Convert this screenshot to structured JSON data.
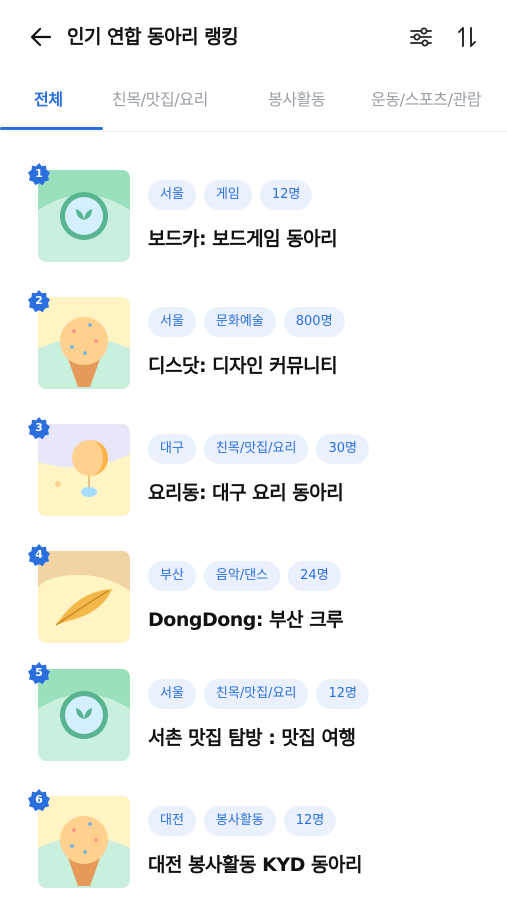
{
  "header": {
    "title": "인기 연합 동아리 랭킹",
    "back_icon": "arrow-left-icon",
    "filter_icon": "sliders-icon",
    "sort_icon": "sort-arrows-icon"
  },
  "tabs": [
    {
      "label": "전체",
      "active": true
    },
    {
      "label": "친목/맛집/요리",
      "active": false
    },
    {
      "label": "봉사활동",
      "active": false
    },
    {
      "label": "운동/스포츠/관람",
      "active": false
    }
  ],
  "colors": {
    "accent": "#2b6fde",
    "tag_bg": "#eaf1fd",
    "rank_badge": "#2b6fde",
    "inactive_tab": "#9aa0a6"
  },
  "clubs": [
    {
      "rank": "1",
      "image": "leaf-circle-image",
      "tags": [
        "서울",
        "게임",
        "12명"
      ],
      "title": "보드카: 보드게임 동아리"
    },
    {
      "rank": "2",
      "image": "ice-cream-image",
      "tags": [
        "서울",
        "문화예술",
        "800명"
      ],
      "title": "디스닷: 디자인 커뮤니티"
    },
    {
      "rank": "3",
      "image": "moon-balloon-image",
      "tags": [
        "대구",
        "친목/맛집/요리",
        "30명"
      ],
      "title": "요리동: 대구 요리 동아리"
    },
    {
      "rank": "4",
      "image": "feather-image",
      "tags": [
        "부산",
        "음악/댄스",
        "24명"
      ],
      "title": "DongDong: 부산 크루"
    },
    {
      "rank": "5",
      "image": "leaf-circle-image",
      "tags": [
        "서울",
        "친목/맛집/요리",
        "12명"
      ],
      "title": "서촌 맛집 탐방 : 맛집 여행"
    },
    {
      "rank": "6",
      "image": "ice-cream-image",
      "tags": [
        "대전",
        "봉사활동",
        "12명"
      ],
      "title": "대전 봉사활동 KYD 동아리"
    }
  ]
}
